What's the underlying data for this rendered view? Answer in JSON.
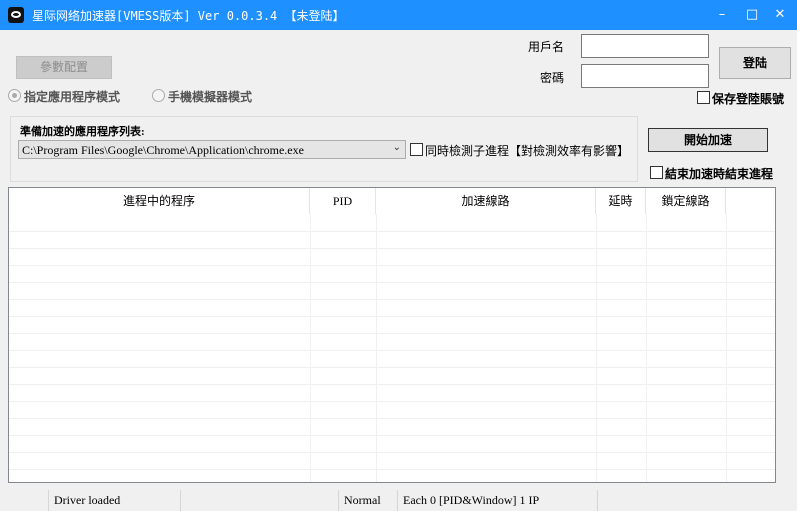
{
  "window": {
    "title": "星际网络加速器[VMESS版本] Ver 0.0.3.4 【未登陆】",
    "minimize": "–",
    "maximize": "□",
    "close": "✕"
  },
  "toolbar": {
    "config_button": "參數配置"
  },
  "modes": {
    "app_mode": "指定應用程序模式",
    "emulator_mode": "手機模擬器模式",
    "selected": "app_mode"
  },
  "login": {
    "username_label": "用戶名",
    "username_value": "",
    "password_label": "密碼",
    "password_value": "",
    "login_button": "登陆",
    "save_account_label": "保存登陸賬號",
    "save_account_checked": false
  },
  "apps_group": {
    "title": "準備加速的應用程序列表:",
    "selected_path": "C:\\Program Files\\Google\\Chrome\\Application\\chrome.exe",
    "detect_children_label": "同時檢測子進程【對檢測效率有影響】",
    "detect_children_checked": false
  },
  "actions": {
    "start_button": "開始加速",
    "end_process_label": "結束加速時結束進程",
    "end_process_checked": false
  },
  "table": {
    "columns": [
      "進程中的程序",
      "PID",
      "加速線路",
      "延時",
      "鎖定線路"
    ],
    "rows": []
  },
  "status": {
    "driver": "Driver loaded",
    "mode": "Normal",
    "info": "Each 0 [PID&Window] 1 IP"
  }
}
